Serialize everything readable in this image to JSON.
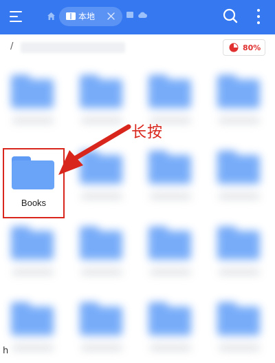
{
  "topbar": {
    "tab_label": "本地",
    "icons": [
      "menu-icon",
      "home-icon",
      "book-icon",
      "close-icon",
      "document-icon",
      "cloud-icon",
      "search-icon",
      "more-vertical-icon"
    ]
  },
  "path": {
    "root": "/",
    "storage_percent": "80%"
  },
  "highlighted_folder": {
    "label": "Books"
  },
  "annotation": {
    "text": "长按"
  },
  "bottom_text": "h",
  "colors": {
    "topbar": "#3578f0",
    "folder": "#6aa4f8",
    "highlight": "#d9261c"
  }
}
